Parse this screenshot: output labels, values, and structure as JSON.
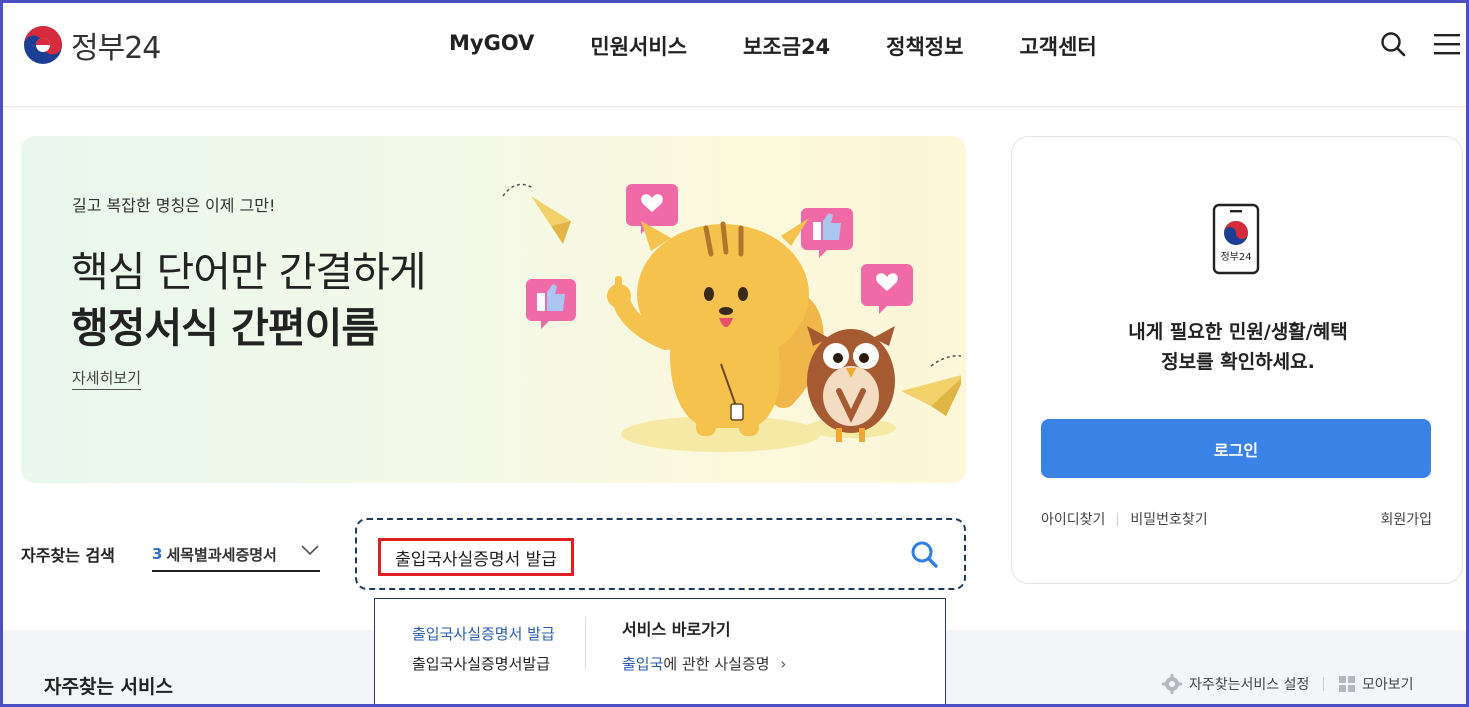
{
  "header": {
    "logo_text": "정부24",
    "nav": [
      "MyGOV",
      "민원서비스",
      "보조금24",
      "정책정보",
      "고객센터"
    ]
  },
  "banner": {
    "small_text": "길고 복잡한 명칭은 이제 그만!",
    "line1": "핵심 단어만 간결하게",
    "line2": "행정서식 간편이름",
    "more_link": "자세히보기"
  },
  "login": {
    "phone_label": "정부24",
    "message_line1": "내게 필요한 민원/생활/혜택",
    "message_line2": "정보를 확인하세요.",
    "button": "로그인",
    "find_id": "아이디찾기",
    "find_pw": "비밀번호찾기",
    "join": "회원가입"
  },
  "frequent_search": {
    "label": "자주찾는 검색",
    "rank": "3",
    "selected": "세목별과세증명서"
  },
  "search": {
    "value": "출입국사실증명서 발급"
  },
  "dropdown": {
    "suggestions": [
      "출입국사실증명서 발급",
      "출입국사실증명서발급"
    ],
    "shortcut_title": "서비스 바로가기",
    "shortcut_highlight": "출입국",
    "shortcut_rest": "에 관한 사실증명",
    "shortcut_arrow": "›"
  },
  "services": {
    "title": "자주찾는 서비스",
    "settings": "자주찾는서비스 설정",
    "view_all": "모아보기"
  },
  "colors": {
    "accent": "#3a82e6",
    "highlight_border": "#e02020",
    "link_blue": "#2a5db0",
    "frame": "#4a4fc4"
  }
}
